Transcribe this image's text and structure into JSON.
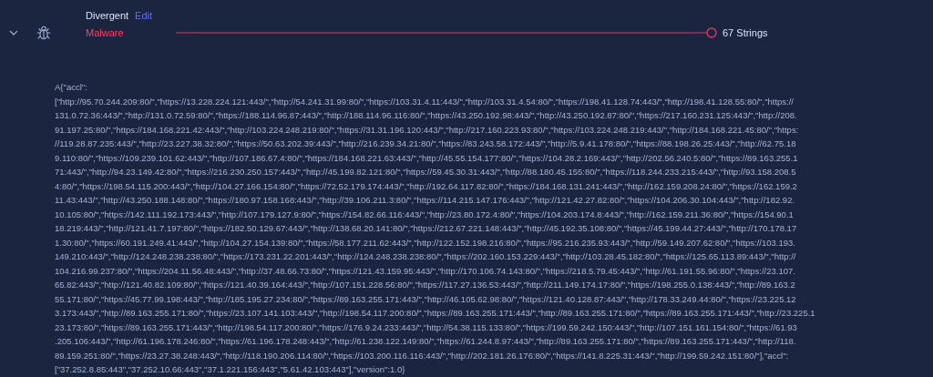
{
  "entry": {
    "expanded": true,
    "name": "Divergent",
    "edit_link": "Edit",
    "category": "Malware",
    "count": "67 Strings"
  },
  "code_block": {
    "lines": [
      "A{\"accl\":",
      "[\"http://95.70.244.209:80/\",\"https://13.228.224.121:443/\",\"http://54.241.31.99:80/\",\"https://103.31.4.11:443/\",\"http://103.31.4.54:80/\",\"https://198.41.128.74:443/\",\"http://198.41.128.55:80/\",\"https://",
      "131.0.72.36:443/\",\"http://131.0.72.59:80/\",\"https://188.114.96.87:443/\",\"http://188.114.96.116:80/\",\"https://43.250.192.98:443/\",\"http://43.250.192.87:80/\",\"https://217.160.231.125:443/\",\"http://208.",
      "91.197.25:80/\",\"https://184.168.221.42:443/\",\"http://103.224.248.219:80/\",\"https://31.31.196.120:443/\",\"http://217.160.223.93:80/\",\"https://103.224.248.219:443/\",\"http://184.168.221.45:80/\",\"https:",
      "//119.28.87.235:443/\",\"http://23.227.38.32:80/\",\"https://50.63.202.39:443/\",\"http://216.239.34.21:80/\",\"https://83.243.58.172:443/\",\"http://5.9.41.178:80/\",\"https://88.198.26.25:443/\",\"http://62.75.18",
      "9.110:80/\",\"https://109.239.101.62:443/\",\"http://107.186.67.4:80/\",\"https://184.168.221.63:443/\",\"http://45.55.154.177:80/\",\"https://104.28.2.169:443/\",\"http://202.56.240.5:80/\",\"https://89.163.255.1",
      "71:443/\",\"http://94.23.149.42:80/\",\"https://216.230.250.157:443/\",\"http://45.199.82.121:80/\",\"https://59.45.30.31:443/\",\"http://88.180.45.155:80/\",\"https://118.244.233.215:443/\",\"http://93.158.208.5",
      "4:80/\",\"https://198.54.115.200:443/\",\"http://104.27.166.154:80/\",\"https://72.52.179.174:443/\",\"http://192.64.117.82:80/\",\"https://184.168.131.241:443/\",\"http://162.159.208.24:80/\",\"https://162.159.2",
      "11.43:443/\",\"http://43.250.188.148:80/\",\"https://180.97.158.168:443/\",\"http://39.106.211.3:80/\",\"https://114.215.147.176:443/\",\"http://121.42.27.82:80/\",\"https://104.206.30.104:443/\",\"http://182.92.",
      "10.105:80/\",\"https://142.111.192.173:443/\",\"http://107.179.127.9:80/\",\"https://154.82.66.116:443/\",\"http://23.80.172.4:80/\",\"https://104.203.174.8:443/\",\"http://162.159.211.36:80/\",\"https://154.90.1",
      "18.219:443/\",\"http://121.41.7.197:80/\",\"https://182.50.129.67:443/\",\"http://138.68.20.141:80/\",\"https://212.67.221.148:443/\",\"http://45.192.35.108:80/\",\"https://45.199.44.27:443/\",\"http://170.178.17",
      "1.30:80/\",\"https://60.191.249.41:443/\",\"http://104.27.154.139:80/\",\"https://58.177.211.62:443/\",\"http://122.152.198.216:80/\",\"https://95.216.235.93:443/\",\"http://59.149.207.62:80/\",\"https://103.193.",
      "149.210:443/\",\"http://124.248.238.238:80/\",\"https://173.231.22.201:443/\",\"http://124.248.238.238:80/\",\"https://202.160.153.229:443/\",\"http://103.28.45.182:80/\",\"https://125.65.113.89:443/\",\"http://",
      "104.216.99.237:80/\",\"https://204.11.56.48:443/\",\"http://37.48.66.73:80/\",\"https://121.43.159.95:443/\",\"http://170.106.74.143:80/\",\"https://218.5.79.45:443/\",\"http://61.191.55.96:80/\",\"https://23.107.",
      "65.82:443/\",\"http://121.40.82.109:80/\",\"https://121.40.39.164:443/\",\"http://107.151.228.56:80/\",\"https://117.27.136.53:443/\",\"http://211.149.174.17:80/\",\"https://198.255.0.138:443/\",\"http://89.163.2",
      "55.171:80/\",\"https://45.77.99.198:443/\",\"http://185.195.27.234:80/\",\"https://89.163.255.171:443/\",\"http://46.105.62.98:80/\",\"https://121.40.128.87:443/\",\"http://178.33.249.44:80/\",\"https://23.225.12",
      "3.173:443/\",\"http://89.163.255.171:80/\",\"https://23.107.141.103:443/\",\"http://198.54.117.200:80/\",\"https://89.163.255.171:443/\",\"http://89.163.255.171:80/\",\"https://89.163.255.171:443/\",\"http://23.225.1",
      "23.173:80/\",\"https://89.163.255.171:443/\",\"http://198.54.117.200:80/\",\"https://176.9.24.233:443/\",\"http://54.38.115.133:80/\",\"https://199.59.242.150:443/\",\"http://107.151.161.154:80/\",\"https://61.93",
      ".205.106:443/\",\"http://61.196.178.246:80/\",\"https://61.196.178.248:443/\",\"http://61.238.122.149:80/\",\"https://61.244.8.97:443/\",\"http://89.163.255.171:80/\",\"https://89.163.255.171:443/\",\"http://118.",
      "89.159.251:80/\",\"https://23.27.38.248:443/\",\"http://118.190.206.114:80/\",\"https://103.200.116.116:443/\",\"http://202.181.26.176:80/\",\"https://141.8.225.31:443/\",\"http://199.59.242.151:80/\"],\"accl\":",
      "[\"37.252.8.85:443\",\"37.252.10.66:443\",\"37.1.221.156:443\",\"5.61.42.103:443\"],\"version\":1.0}"
    ]
  }
}
